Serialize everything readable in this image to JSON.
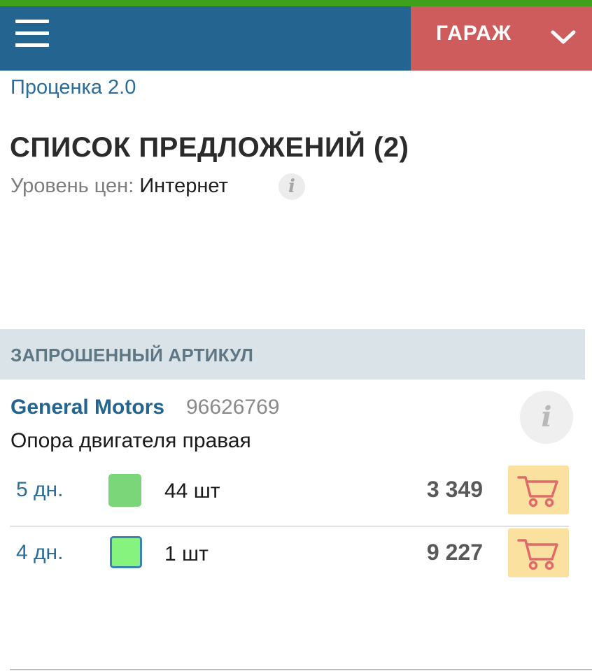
{
  "header": {
    "menu_icon": "hamburger-icon",
    "garage_label": "ГАРАЖ",
    "garage_icon": "chevron-down-icon"
  },
  "breadcrumb": "Проценка 2.0",
  "page_title": "СПИСОК ПРЕДЛОЖЕНИЙ (2)",
  "price_level": {
    "label": "Уровень цен:",
    "value": "Интернет",
    "info_icon": "info-icon"
  },
  "section": {
    "title": "ЗАПРОШЕННЫЙ АРТИКУЛ"
  },
  "part": {
    "brand": "General Motors",
    "article": "96626769",
    "description": "Опора двигателя правая",
    "info_icon": "info-icon"
  },
  "offers": [
    {
      "days": "5 дн.",
      "quantity": "44 шт",
      "price": "3 349",
      "currency_symbol": "",
      "stock_color": "#7bd67a",
      "cart_icon": "cart-icon"
    },
    {
      "days": "4 дн.",
      "quantity": "1 шт",
      "price": "9 227",
      "currency_symbol": "",
      "stock_color": "#86f37e",
      "cart_icon": "cart-icon"
    }
  ],
  "colors": {
    "header_bg": "#236590",
    "garage_bg": "#cf5c5c",
    "top_stripe": "#3fa01b",
    "link": "#2a6d99",
    "cart_bg": "#fbe1a0",
    "cart_icon": "#e06a6a"
  }
}
